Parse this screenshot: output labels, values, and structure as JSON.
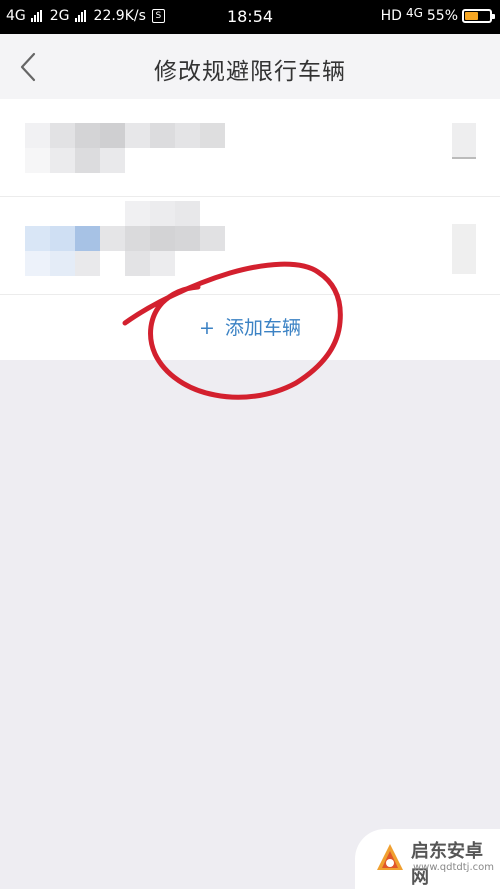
{
  "status_bar": {
    "sim1": "4G",
    "sim2": "2G",
    "net_speed": "22.9K/s",
    "sim_icon_letter": "S",
    "time": "18:54",
    "hd_label": "HD",
    "net_type": "4G",
    "battery_percent": "55%",
    "battery_level": 0.55,
    "battery_color": "#f5a623"
  },
  "header": {
    "title": "修改规避限行车辆",
    "back_icon": "chevron-left-icon"
  },
  "list": {
    "vehicles_note": "2 vehicle rows, content pixelated",
    "add_button": {
      "icon": "+",
      "label": "添加车辆",
      "color": "#3b82c4"
    }
  },
  "annotation": {
    "color": "#d3202e"
  },
  "watermark": {
    "name": "启东安卓网",
    "url": "www.qdtdtj.com"
  }
}
